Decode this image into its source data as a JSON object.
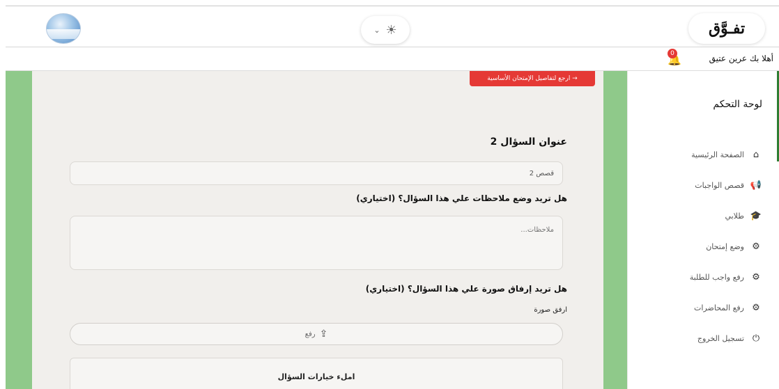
{
  "header": {
    "logo_text": "تفـوَّق",
    "theme_toggle": {
      "chevron": "⌄",
      "icon": "sun-icon",
      "glyph": "☀"
    },
    "avatar": "avatar-image"
  },
  "greetbar": {
    "greeting": "أهلا بك عرين عتيق",
    "notification_count": "0",
    "bell_icon": "🔔"
  },
  "sidebar": {
    "title": "لوحة التحكم",
    "items": [
      {
        "label": "الصفحة الرئيسية",
        "icon": "home-icon",
        "glyph": "⌂"
      },
      {
        "label": "قصص الواجبات",
        "icon": "megaphone-icon",
        "glyph": "📢"
      },
      {
        "label": "طلابي",
        "icon": "graduation-icon",
        "glyph": "🎓"
      },
      {
        "label": "وضع إمتحان",
        "icon": "gear-icon",
        "glyph": "⚙"
      },
      {
        "label": "رفع واجب للطلبة",
        "icon": "gear-icon",
        "glyph": "⚙"
      },
      {
        "label": "رفع المحاضرات",
        "icon": "gear-icon",
        "glyph": "⚙"
      },
      {
        "label": "تسجيل الخروج",
        "icon": "power-icon",
        "glyph": "⏻"
      }
    ]
  },
  "main": {
    "back_button": "→ ارجع لتفاصيل الإمتحان الأساسية",
    "question_title": "عنوان السؤال 2",
    "question_value": "قصص 2",
    "notes_label": "هل تريد وضع ملاحظات علي هذا السؤال؟ (اختياري)",
    "notes_placeholder": "ملاحظات...",
    "image_label": "هل تريد إرفاق صورة علي هذا السؤال؟ (اختياري)",
    "attach_label": "ارفق صورة",
    "upload_label": "رفع",
    "options_title": "املء خيارات السؤال"
  },
  "colors": {
    "accent_green": "#8fc98a",
    "danger_red": "#e53935",
    "sidebar_accent": "#2e7d32"
  }
}
